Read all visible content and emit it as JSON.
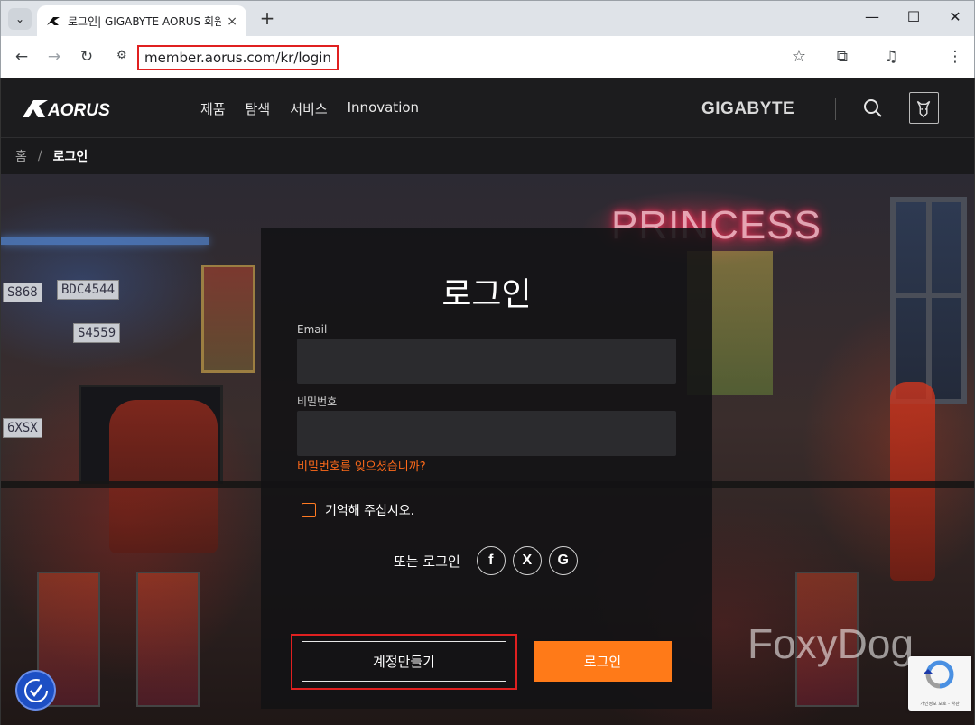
{
  "browser": {
    "tab_title": "로그인| GIGABYTE AORUS 회원",
    "tab_close": "×",
    "new_tab": "+",
    "url": "member.aorus.com/kr/login",
    "win_min": "—",
    "win_max": "☐",
    "win_close": "✕"
  },
  "header": {
    "nav": [
      "제품",
      "탐색",
      "서비스",
      "Innovation"
    ],
    "brand": "GIGABYTE"
  },
  "breadcrumb": {
    "home": "홈",
    "separator": "/",
    "current": "로그인"
  },
  "hero": {
    "neon_sign": "PRINCESS",
    "plates": [
      "S868",
      "BDC4544",
      "S4559",
      "6XSX"
    ]
  },
  "login": {
    "title": "로그인",
    "email_label": "Email",
    "password_label": "비밀번호",
    "forgot": "비밀번호를 잊으셨습니까?",
    "remember": "기억해 주십시오.",
    "social_text": "또는 로그인",
    "social": [
      {
        "name": "facebook-icon",
        "glyph": "f"
      },
      {
        "name": "x-icon",
        "glyph": "X"
      },
      {
        "name": "google-icon",
        "glyph": "G"
      }
    ],
    "signup_button": "계정만들기",
    "login_button": "로그인"
  },
  "watermark": "FoxyDog",
  "recaptcha_text": "개인정보 보호 - 약관",
  "colors": {
    "accent": "#ff7a18",
    "forgot_link": "#ff6a1a",
    "highlight_box": "#e02020"
  }
}
